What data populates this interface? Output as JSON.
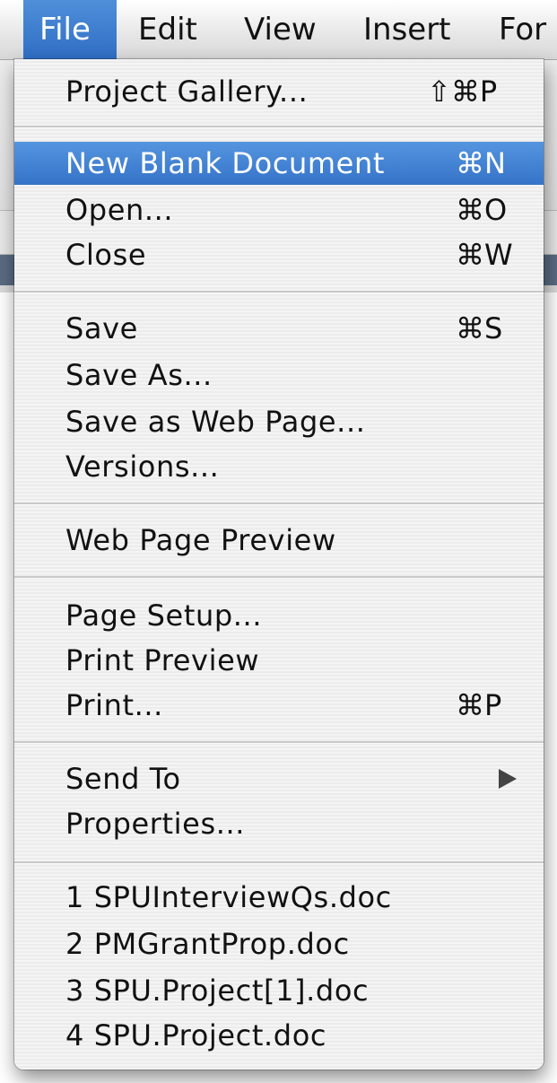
{
  "menubar": {
    "items": [
      {
        "label": "File",
        "active": true
      },
      {
        "label": "Edit"
      },
      {
        "label": "View"
      },
      {
        "label": "Insert"
      },
      {
        "label": "For"
      }
    ]
  },
  "file_menu": {
    "project_gallery": {
      "label": "Project Gallery...",
      "shortcut": "⇧⌘P"
    },
    "new_blank_document": {
      "label": "New Blank Document",
      "shortcut": "⌘N",
      "highlighted": true
    },
    "open": {
      "label": "Open...",
      "shortcut": "⌘O"
    },
    "close": {
      "label": "Close",
      "shortcut": "⌘W"
    },
    "save": {
      "label": "Save",
      "shortcut": "⌘S"
    },
    "save_as": {
      "label": "Save As..."
    },
    "save_as_web": {
      "label": "Save as Web Page..."
    },
    "versions": {
      "label": "Versions..."
    },
    "web_preview": {
      "label": "Web Page Preview"
    },
    "page_setup": {
      "label": "Page Setup..."
    },
    "print_preview": {
      "label": "Print Preview"
    },
    "print": {
      "label": "Print...",
      "shortcut": "⌘P"
    },
    "send_to": {
      "label": "Send To",
      "icon": "submenu-arrow-icon"
    },
    "properties": {
      "label": "Properties..."
    },
    "recent": [
      "1 SPUInterviewQs.doc",
      "2 PMGrantProp.doc",
      "3 SPU.Project[1].doc",
      "4 SPU.Project.doc"
    ]
  },
  "colors": {
    "highlight": "#3a78cc",
    "menu_bg": "#f1f1f1"
  }
}
